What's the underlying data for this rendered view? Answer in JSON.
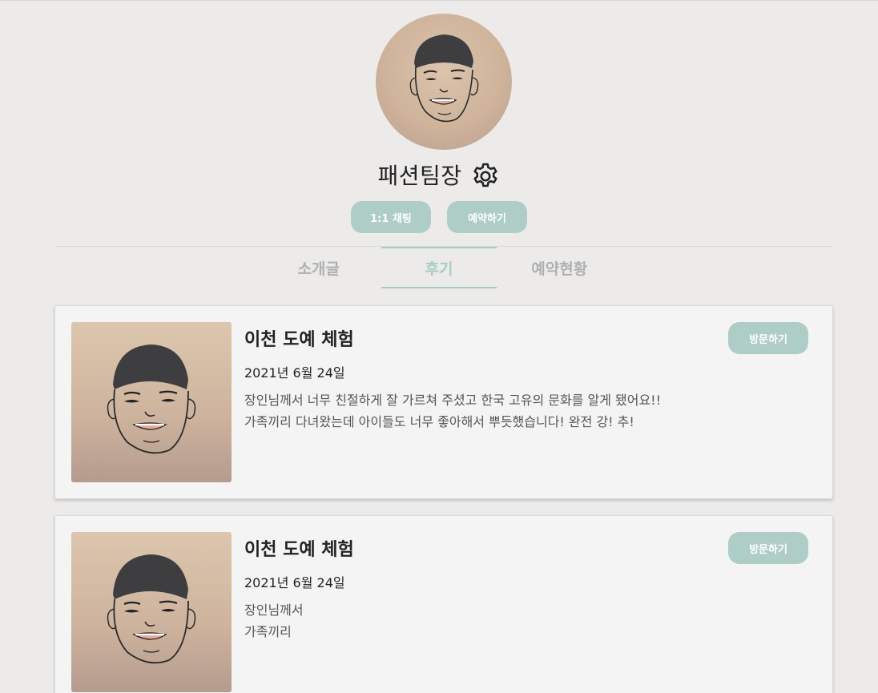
{
  "profile": {
    "name": "패션팀장",
    "avatar_alt": "profile-avatar-drawing",
    "settings_icon": "gear-icon"
  },
  "actions": {
    "chat_label": "1:1 채팅",
    "reserve_label": "예약하기"
  },
  "tabs": [
    {
      "label": "소개글",
      "active": false
    },
    {
      "label": "후기",
      "active": true
    },
    {
      "label": "예약현황",
      "active": false
    }
  ],
  "reviews": [
    {
      "title": "이천 도예 체험",
      "date": "2021년 6월 24일",
      "lines": [
        "장인님께서 너무 친절하게 잘 가르쳐 주셨고 한국 고유의 문화를 알게 됐어요!!",
        "가족끼리 다녀왔는데 아이들도 너무 좋아해서 뿌듯했습니다! 완전 강! 추!"
      ],
      "visit_label": "방문하기"
    },
    {
      "title": "이천 도예 체험",
      "date": "2021년 6월 24일",
      "lines": [
        "장인님께서",
        "가족끼리"
      ],
      "visit_label": "방문하기"
    }
  ],
  "colors": {
    "accent": "#aecdc6",
    "tab_active": "#a7cdc3",
    "tab_inactive": "#b0b0b0",
    "background": "#ecebea",
    "card_bg": "#f4f4f4"
  }
}
